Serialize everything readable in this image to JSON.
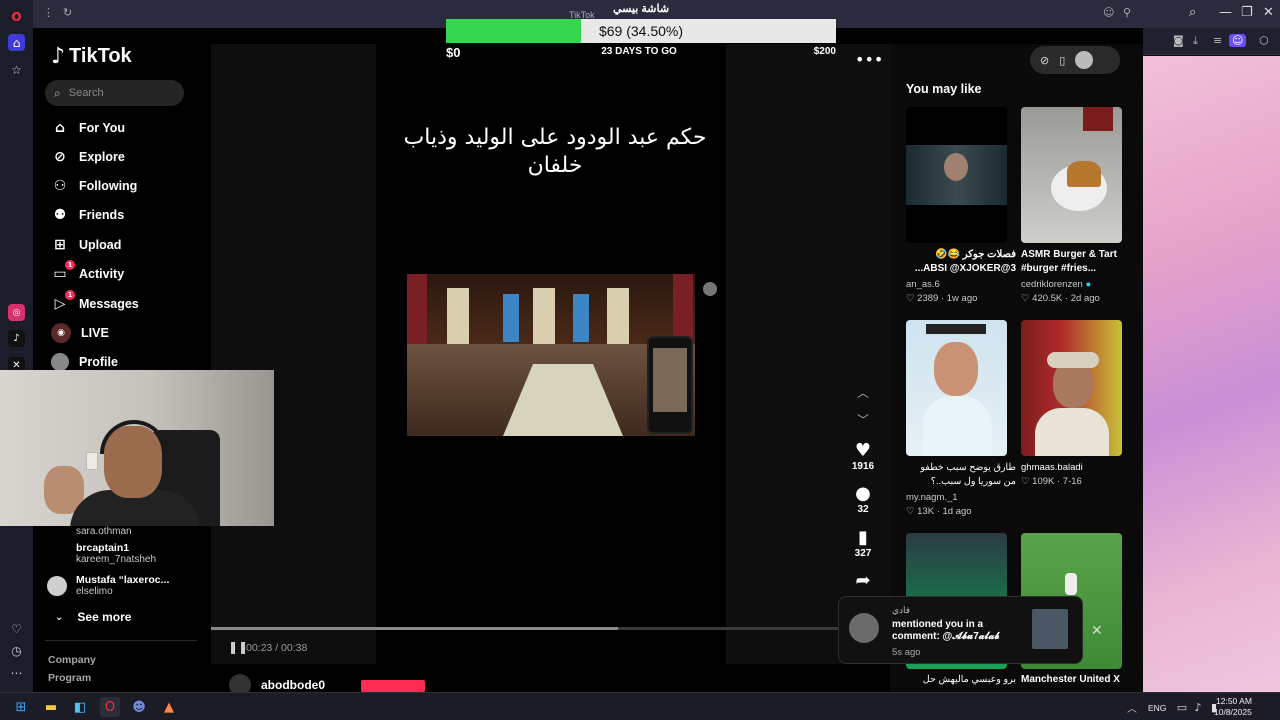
{
  "browser": {
    "tab_title": "TikTok",
    "icons": [
      "opera-icon",
      "home-icon",
      "star-icon",
      "instagram-icon",
      "tiktok-icon",
      "x-icon",
      "heart-icon",
      "history-icon",
      "more-icon"
    ]
  },
  "goal": {
    "label": "شاشة بيسي",
    "amount_text": "$69 (34.50%)",
    "fraction": 0.345,
    "min": "$0",
    "days": "23 DAYS TO GO",
    "max": "$200",
    "fill_color": "#35d64f"
  },
  "tiktok": {
    "logo": "TikTok",
    "search_placeholder": "Search",
    "nav": [
      {
        "label": "For You",
        "icon": "home-icon"
      },
      {
        "label": "Explore",
        "icon": "compass-icon"
      },
      {
        "label": "Following",
        "icon": "following-icon"
      },
      {
        "label": "Friends",
        "icon": "friends-icon"
      },
      {
        "label": "Upload",
        "icon": "upload-icon"
      },
      {
        "label": "Activity",
        "icon": "activity-icon",
        "badge": "1"
      },
      {
        "label": "Messages",
        "icon": "messages-icon",
        "badge": "1"
      },
      {
        "label": "LIVE",
        "icon": "live-icon"
      },
      {
        "label": "Profile",
        "icon": "profile-icon"
      }
    ],
    "following_accounts": [
      {
        "name": "",
        "user": "sara.othman"
      },
      {
        "name": "brcaptain1",
        "user": "kareem_7natsheh"
      },
      {
        "name": "Mustafa “laxeroc...",
        "user": "elselimo"
      }
    ],
    "see_more": "See more",
    "footer": [
      "Company",
      "Program"
    ],
    "video": {
      "caption": "حكم عبد الودود على الوليد وذياب خلفان",
      "time": "00:23 / 00:38",
      "progress": 0.6,
      "author": "abodbode0"
    },
    "actions": [
      {
        "icon": "heart-icon",
        "count": "1916"
      },
      {
        "icon": "comment-icon",
        "count": "32"
      },
      {
        "icon": "bookmark-icon",
        "count": "327"
      },
      {
        "icon": "share-icon",
        "count": ""
      }
    ],
    "right_panel": {
      "title": "You may like",
      "cards": [
        {
          "text": "فصلات جوكر 😂🤣\n3@ABSI @XJOKER...",
          "user": "an_as.6",
          "likes": "2389",
          "age": "1w ago"
        },
        {
          "text": "ASMR Burger & Tart #burger #fries...",
          "user": "cedriklorenzen",
          "likes": "420.5K",
          "age": "2d ago"
        },
        {
          "text": "طارق يوضح سبب خطفو من سوريا ول سبب..؟",
          "user": "my.nagm._1",
          "likes": "13K",
          "age": "1d ago"
        },
        {
          "text": "",
          "user": "ghmaas.baladi",
          "likes": "109K",
          "age": "7-16"
        },
        {
          "text": "برو وعبسي ماليهش حل",
          "user": "",
          "likes": "",
          "age": ""
        },
        {
          "text": "Manchester United X",
          "user": "",
          "likes": "",
          "age": ""
        }
      ]
    },
    "notification": {
      "sender": "فادي",
      "message": "mentioned you in a comment: @𝓐𝓫𝓾7𝓪𝓵𝓪𝓫",
      "time": "5s ago"
    }
  },
  "taskbar": {
    "lang": "ENG",
    "time": "12:50 AM",
    "date": "10/8/2025"
  }
}
